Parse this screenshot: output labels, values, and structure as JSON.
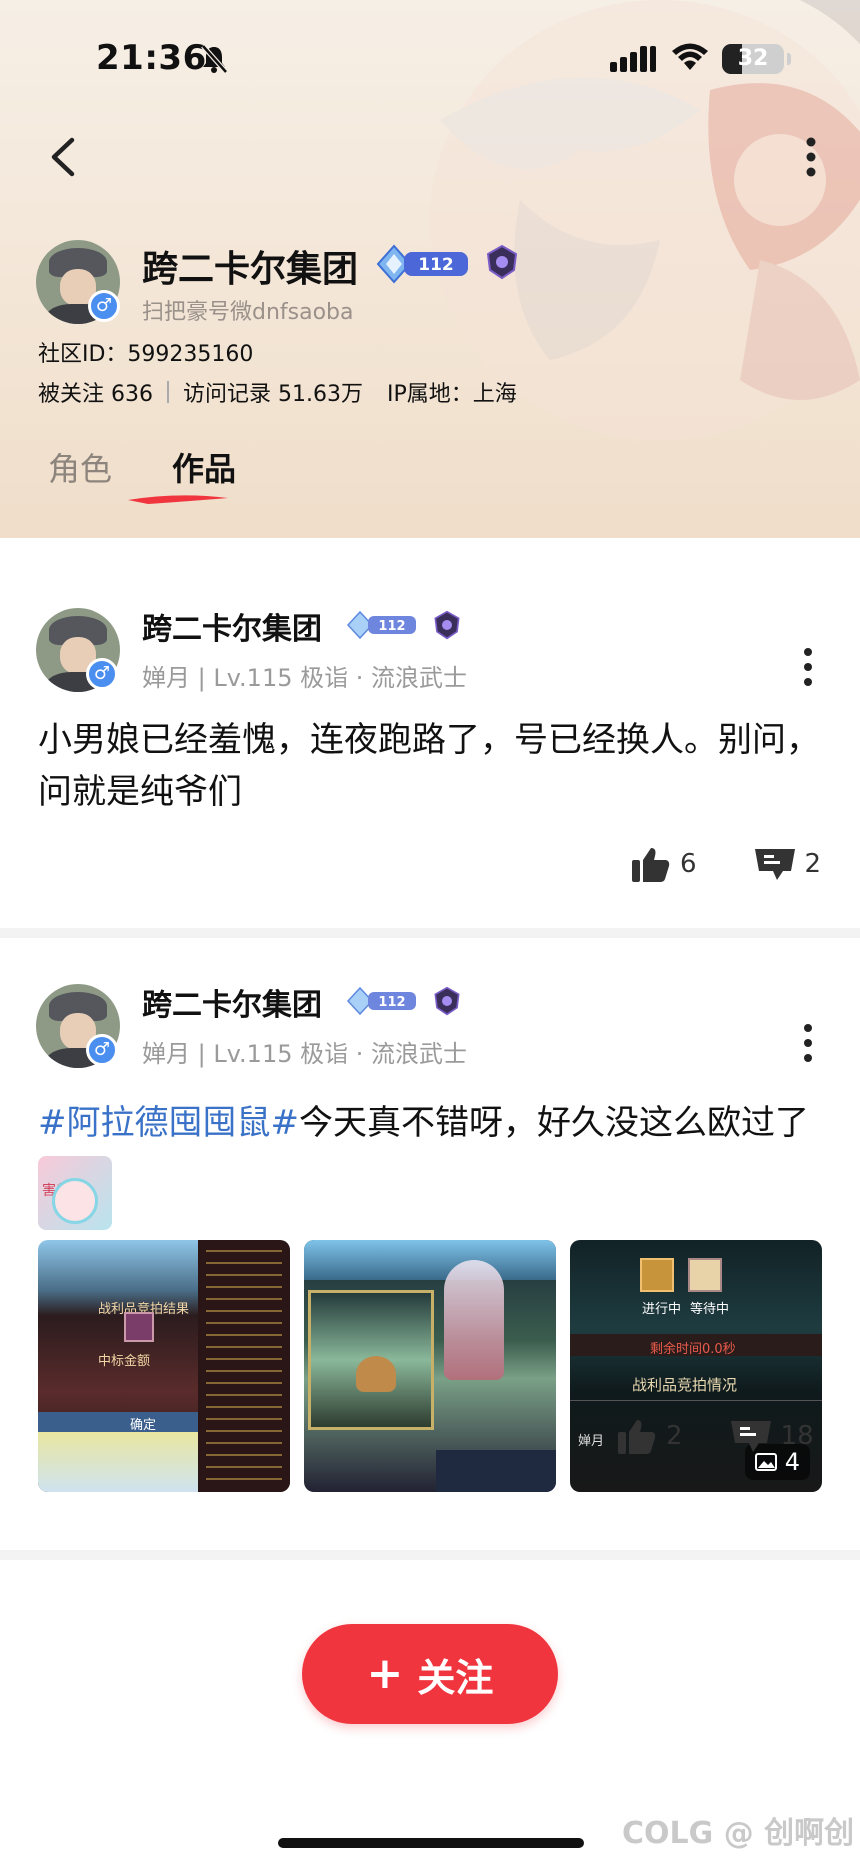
{
  "status_bar": {
    "time": "21:36",
    "battery": "32",
    "battery_level": 0.32
  },
  "profile": {
    "name": "跨二卡尔集团",
    "level_badge": "112",
    "subtitle": "扫把豪号微dnfsaoba",
    "community_id": "社区ID：599235160",
    "followers": "被关注 636",
    "visits": "访问记录 51.63万",
    "ip_location": "IP属地：上海",
    "gender_icon": "male-icon"
  },
  "tabs": [
    {
      "label": "角色",
      "active": false
    },
    {
      "label": "作品",
      "active": true
    }
  ],
  "posts": [
    {
      "author": "跨二卡尔集团",
      "level_badge": "112",
      "meta": "婵月 | Lv.115 极诣 · 流浪武士",
      "text": "小男娘已经羞愧，连夜跑路了，号已经换人。别问，问就是纯爷们",
      "likes": "6",
      "comments": "2"
    },
    {
      "author": "跨二卡尔集团",
      "level_badge": "112",
      "meta": "婵月 | Lv.115 极诣 · 流浪武士",
      "hashtag": "#阿拉德囤囤鼠#",
      "text": "今天真不错呀，好久没这么欧过了",
      "sticker_text": "害羞",
      "image_count": "4",
      "image_texts": [
        "战利品竞拍结果",
        "中标金额",
        "确定",
        "进行中",
        "等待中",
        "剩余时间0.0秒",
        "战利品竞拍情况",
        "婵月"
      ],
      "likes": "2",
      "comments": "18"
    }
  ],
  "follow_button": {
    "icon": "+",
    "label": "关注"
  },
  "watermark": "COLG @ 创啊创",
  "colors": {
    "accent": "#f0353f",
    "hashtag": "#3a72c8",
    "gender": "#4a8ef0"
  }
}
